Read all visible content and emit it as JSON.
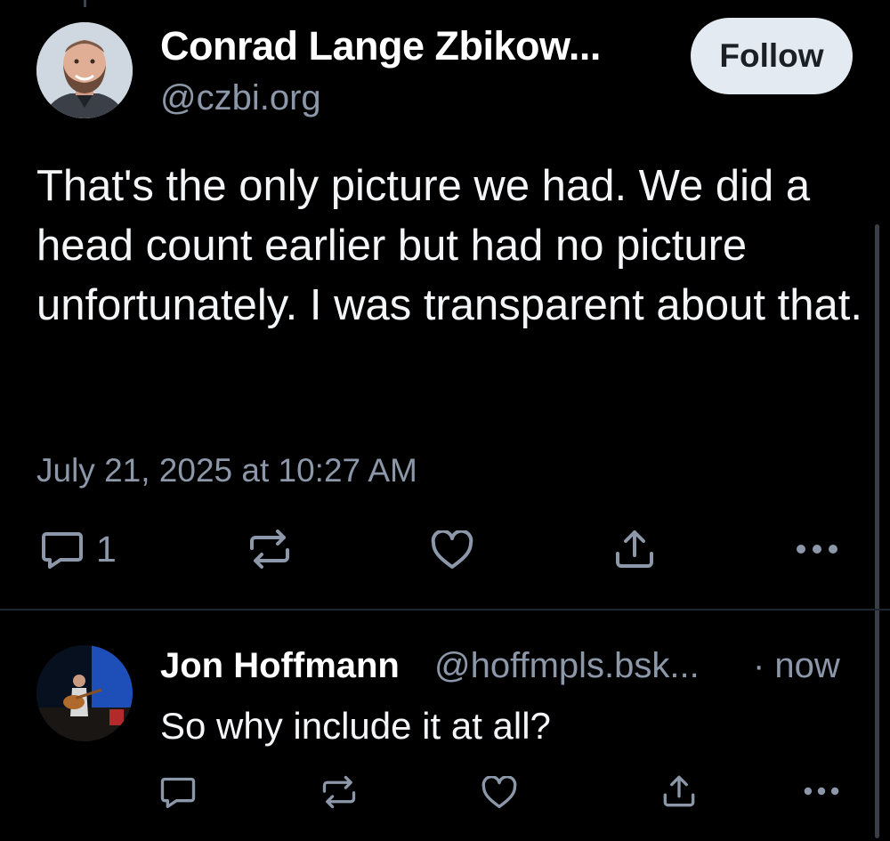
{
  "post": {
    "author_name": "Conrad Lange Zbikow...",
    "author_handle": "@czbi.org",
    "follow_label": "Follow",
    "text": "That's the only picture we had. We did a head count earlier but had no picture unfortunately. I was transparent about that.",
    "timestamp": "July 21, 2025 at 10:27 AM",
    "reply_count": "1",
    "icons": [
      "reply-icon",
      "repost-icon",
      "like-icon",
      "share-icon",
      "more-icon"
    ]
  },
  "reply": {
    "author_name": "Jon Hoffmann",
    "author_handle": "@hoffmpls.bsk...",
    "time": "· now",
    "text": "So why include it at all?",
    "icons": [
      "reply-icon",
      "repost-icon",
      "like-icon",
      "share-icon",
      "more-icon"
    ]
  },
  "colors": {
    "background": "#000000",
    "text_primary": "#f3f5f7",
    "text_secondary": "#8c98a9",
    "icon": "#8c98a9",
    "follow_bg": "#e4eaf1"
  }
}
